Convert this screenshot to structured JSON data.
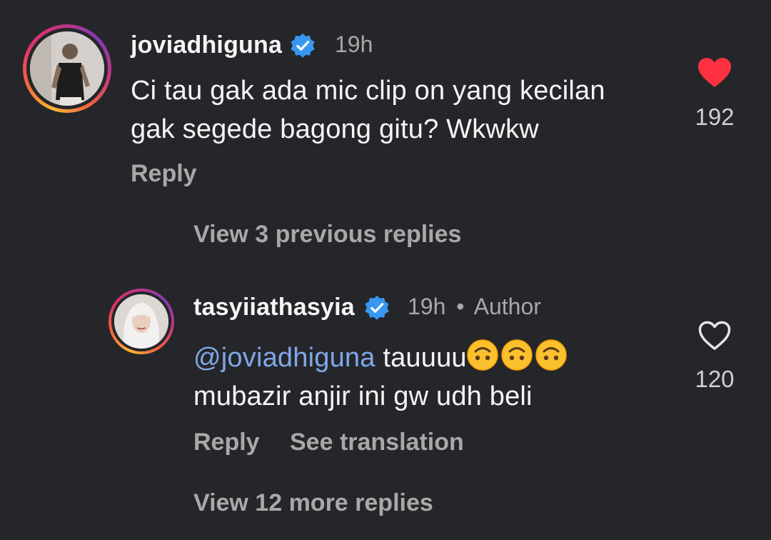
{
  "comments": [
    {
      "username": "joviadhiguna",
      "time": "19h",
      "text_lines": [
        "Ci tau gak ada mic clip on yang kecilan",
        "gak segede bagong gitu? Wkwkw"
      ],
      "reply_label": "Reply",
      "like_count": "192",
      "liked": true
    },
    {
      "username": "tasyiiathasyia",
      "time": "19h",
      "separator": "•",
      "author_label": "Author",
      "mention": "@joviadhiguna",
      "text_line1_rest": " tauuuu",
      "emojis": [
        "upside-down-face",
        "upside-down-face",
        "upside-down-face"
      ],
      "text_line2": "mubazir anjir ini gw udh beli",
      "reply_label": "Reply",
      "translate_label": "See translation",
      "like_count": "120",
      "liked": false
    }
  ],
  "thread": {
    "view_previous": "View 3 previous replies",
    "view_more": "View 12 more replies"
  },
  "colors": {
    "background": "#25262a",
    "heart_liked": "#ff3040",
    "verified": "#3897f0",
    "mention": "#7fa8e8",
    "muted": "#a8a8a8"
  }
}
